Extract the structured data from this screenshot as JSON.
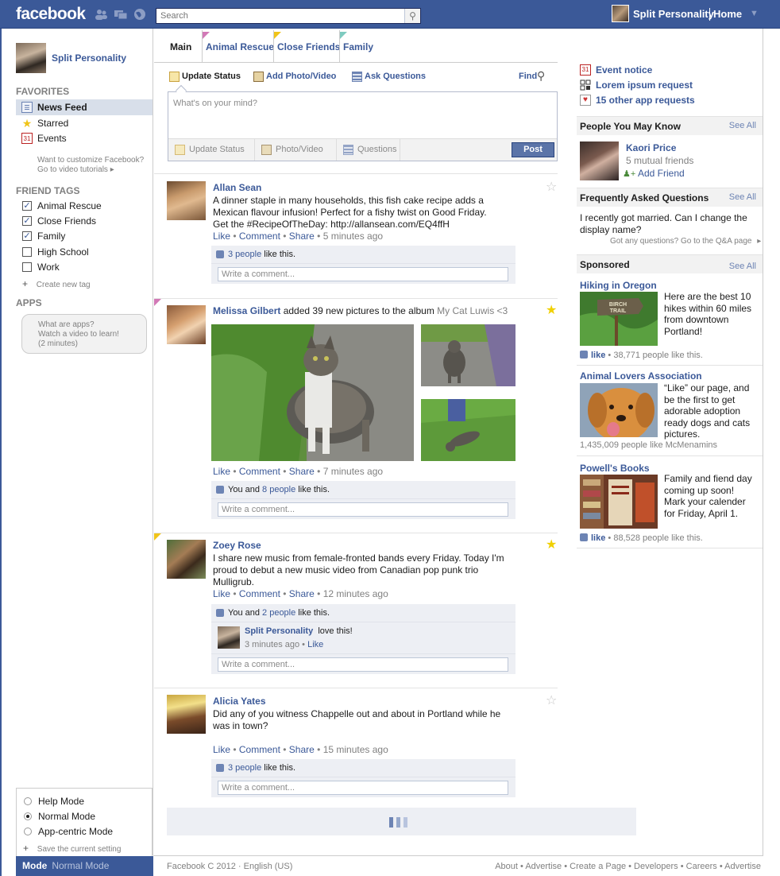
{
  "topbar": {
    "logo": "facebook",
    "search_placeholder": "Search",
    "user_name": "Split Personality",
    "home": "Home"
  },
  "sidebar": {
    "profile_name": "Split Personality",
    "favorites_head": "FAVORITES",
    "favorites": [
      {
        "label": "News Feed",
        "icon": "news-feed-icon"
      },
      {
        "label": "Starred",
        "icon": "star-icon"
      },
      {
        "label": "Events",
        "icon": "calendar-icon",
        "icon_text": "31"
      }
    ],
    "customize_line1": "Want to customize Facebook?",
    "customize_line2": "Go to video tutorials",
    "friend_tags_head": "FRIEND TAGS",
    "friend_tags": [
      {
        "label": "Animal Rescue",
        "checked": true
      },
      {
        "label": "Close Friends",
        "checked": true
      },
      {
        "label": "Family",
        "checked": true
      },
      {
        "label": "High School",
        "checked": false
      },
      {
        "label": "Work",
        "checked": false
      }
    ],
    "create_tag": "Create new tag",
    "apps_head": "APPS",
    "apps_box": [
      "What are apps?",
      "Watch a video to learn!",
      "(2 minutes)"
    ],
    "modes": [
      {
        "label": "Help Mode",
        "selected": false
      },
      {
        "label": "Normal Mode",
        "selected": true
      },
      {
        "label": "App-centric Mode",
        "selected": false
      }
    ],
    "save_setting": "Save the current setting",
    "mode_bar_label": "Mode",
    "mode_bar_value": "Normal Mode"
  },
  "tabs": [
    {
      "label": "Main",
      "color": ""
    },
    {
      "label": "Animal Rescue",
      "color": "#d279b6"
    },
    {
      "label": "Close Friends",
      "color": "#f0c419"
    },
    {
      "label": "Family",
      "color": "#7ecbc0"
    }
  ],
  "composer": {
    "links": [
      "Update Status",
      "Add Photo/Video",
      "Ask Questions"
    ],
    "find": "Find",
    "placeholder": "What's on your mind?",
    "bar": [
      "Update Status",
      "Photo/Video",
      "Questions"
    ],
    "post": "Post"
  },
  "posts": [
    {
      "name": "Allan Sean",
      "text": [
        "A dinner staple in many households, this fish cake recipe adds a",
        "Mexican flavour infusion! Perfect for a fishy twist on Good Friday.",
        "Get the #RecipeOfTheDay: http://allansean.com/EQ4ffH"
      ],
      "actions": [
        "Like",
        "Comment",
        "Share"
      ],
      "time": "5 minutes ago",
      "likes_link": "3 people",
      "likes_rest": " like this.",
      "comment_placeholder": "Write a comment...",
      "starred": false
    },
    {
      "name": "Melissa Gilbert",
      "action": " added 39 new pictures to the album ",
      "album": "My Cat Luwis <3",
      "actions": [
        "Like",
        "Comment",
        "Share"
      ],
      "time": "7 minutes ago",
      "likes_pre": "You and ",
      "likes_link": "8 people",
      "likes_rest": " like this.",
      "comment_placeholder": "Write a comment...",
      "starred": true
    },
    {
      "name": "Zoey Rose",
      "text": [
        "I share new music from female-fronted bands every Friday. Today I'm",
        "proud to debut a new music video from Canadian pop punk trio",
        "Mulligrub."
      ],
      "actions": [
        "Like",
        "Comment",
        "Share"
      ],
      "time": "12 minutes ago",
      "likes_pre": "You and ",
      "likes_link": "2 people",
      "likes_rest": " like this.",
      "reply_name": "Split Personality",
      "reply_text": "love this!",
      "reply_time": "3 minutes ago",
      "reply_like": "Like",
      "comment_placeholder": "Write a comment...",
      "starred": true
    },
    {
      "name": "Alicia Yates",
      "text": [
        "Did any of you witness Chappelle out and about in Portland while he",
        "was in town?"
      ],
      "actions": [
        "Like",
        "Comment",
        "Share"
      ],
      "time": "15 minutes ago",
      "likes_link": "3 people",
      "likes_rest": " like this.",
      "comment_placeholder": "Write a comment...",
      "starred": false
    }
  ],
  "footer": {
    "left": "Facebook C 2012 · English (US)",
    "links": [
      "About",
      "Advertise",
      "Create a Page",
      "Developers",
      "Careers",
      "Advertise"
    ]
  },
  "right": {
    "notices": [
      {
        "label": "Event notice",
        "icon": "calendar-icon",
        "icon_text": "31"
      },
      {
        "label": "Lorem ipsum request",
        "icon": "grid-icon"
      },
      {
        "label": "15 other app requests",
        "icon": "heart-icon"
      }
    ],
    "pymk_head": "People You May Know",
    "see_all": "See All",
    "pymk_name": "Kaori Price",
    "pymk_mutual": "5 mutual friends",
    "pymk_add": "Add Friend",
    "faq_head": "Frequently Asked Questions",
    "faq_question": [
      "I recently got married. Can I change the",
      "display name?"
    ],
    "faq_link": "Got any questions? Go to the Q&A page",
    "sponsored_head": "Sponsored",
    "ads": [
      {
        "title": "Hiking in Oregon",
        "text": [
          "Here are the best 10",
          "hikes within 60 miles",
          "from downtown",
          "Portland!"
        ],
        "like": "like",
        "count": " • 38,771 people like this.",
        "sign_text": [
          "BIRCH",
          "TRAIL"
        ]
      },
      {
        "title": "Animal Lovers Association",
        "text": [
          "“Like” our page, and",
          "be the first to get",
          "adorable adoption",
          "ready dogs and cats",
          "pictures."
        ],
        "count_only": "1,435,009 people like McMenamins"
      },
      {
        "title": "Powell's Books",
        "text": [
          "Family and fiend day",
          "coming up soon!",
          "Mark your calender",
          "for Friday, April 1."
        ],
        "like": "like",
        "count": " • 88,528 people like this."
      }
    ]
  }
}
